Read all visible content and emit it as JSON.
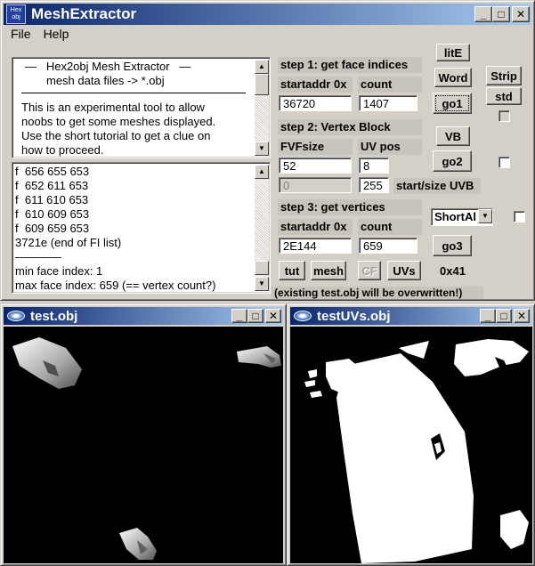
{
  "main_window": {
    "title": "MeshExtractor",
    "app_icon_text": "Hex obj",
    "menu": [
      "File",
      "Help"
    ]
  },
  "info": {
    "line1": "—   Hex2obj Mesh Extractor   —",
    "line2": "mesh data files -> *.obj",
    "body": [
      "This is an experimental tool to allow",
      "noobs to get some meshes displayed.",
      "Use the short tutorial to get a clue on",
      "how to proceed."
    ]
  },
  "log": {
    "lines": [
      "f  656 655 653",
      "f  652 611 653",
      "f  611 610 653",
      "f  610 609 653",
      "f  609 659 653",
      "3721e (end of FI list)",
      "————",
      "min face index: 1",
      "max face index: 659 (== vertex count?)"
    ]
  },
  "step1": {
    "label": "step 1: get face indices",
    "startaddr_label": "startaddr 0x",
    "count_label": "count",
    "startaddr": "36720",
    "count": "1407"
  },
  "step2": {
    "label": "step 2: Vertex Block",
    "fvf_label": "FVFsize",
    "uv_label": "UV pos",
    "fvf": "52",
    "uv": "8",
    "uvb_start": "0",
    "uvb_size": "255",
    "uvb_label": "start/size UVB"
  },
  "step3": {
    "label": "step 3: get vertices",
    "startaddr_label": "startaddr 0x",
    "count_label": "count",
    "startaddr": "2E144",
    "count": "659"
  },
  "buttons": {
    "lite": "litE",
    "word": "Word",
    "go1": "go1",
    "strip": "Strip",
    "std": "std",
    "vb": "VB",
    "go2": "go2",
    "go3": "go3",
    "hex41": "0x41",
    "tut": "tut",
    "mesh": "mesh",
    "cf": "CF",
    "uvs": "UVs"
  },
  "dropdown": {
    "value": "ShortAl"
  },
  "status": "(existing test.obj will be overwritten!)",
  "windows": {
    "left_title": "test.obj",
    "right_title": "testUVs.obj"
  }
}
